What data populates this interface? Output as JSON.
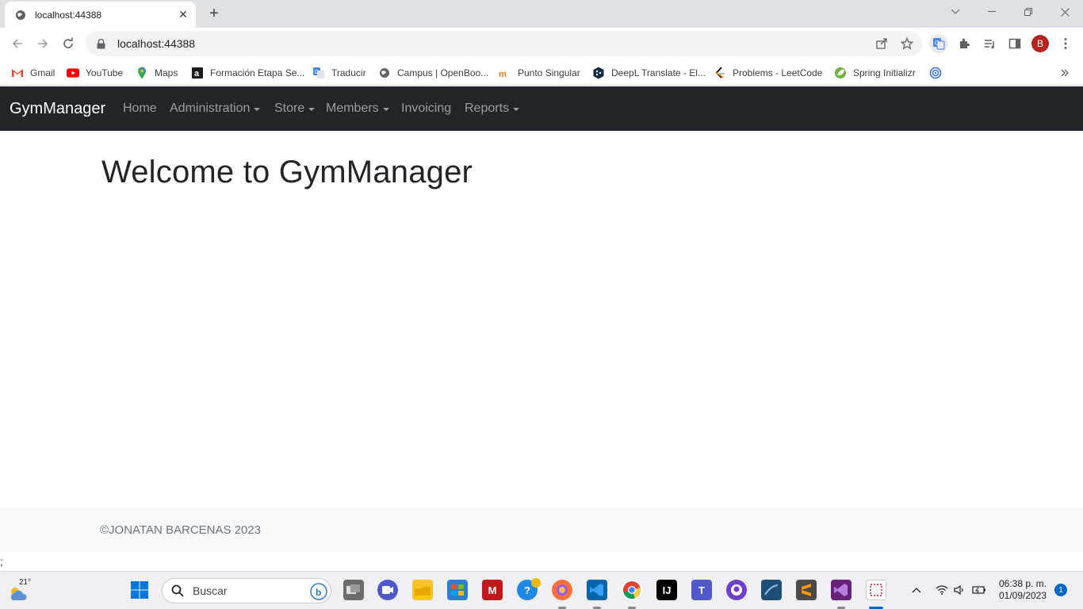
{
  "browser": {
    "tab_title": "localhost:44388",
    "url": "localhost:44388",
    "new_tab_label": "+",
    "profile_initial": "B"
  },
  "bookmarks": [
    {
      "label": "Gmail",
      "icon": "gmail-icon"
    },
    {
      "label": "YouTube",
      "icon": "youtube-icon"
    },
    {
      "label": "Maps",
      "icon": "maps-icon"
    },
    {
      "label": "Formación Etapa Se...",
      "icon": "academy-icon"
    },
    {
      "label": "Traducir",
      "icon": "translate-icon"
    },
    {
      "label": "Campus | OpenBoo...",
      "icon": "globe-icon"
    },
    {
      "label": "Punto Singular",
      "icon": "puntosingular-icon"
    },
    {
      "label": "DeepL Translate - El...",
      "icon": "deepl-icon"
    },
    {
      "label": "Problems - LeetCode",
      "icon": "leetcode-icon"
    },
    {
      "label": "Spring Initializr",
      "icon": "spring-icon"
    }
  ],
  "navbar": {
    "brand": "GymManager",
    "items": [
      {
        "label": "Home",
        "dropdown": false
      },
      {
        "label": "Administration",
        "dropdown": true
      },
      {
        "label": "Store",
        "dropdown": true
      },
      {
        "label": "Members",
        "dropdown": true
      },
      {
        "label": "Invoicing",
        "dropdown": false
      },
      {
        "label": "Reports",
        "dropdown": true
      }
    ]
  },
  "main": {
    "heading": "Welcome to GymManager"
  },
  "footer": {
    "text": "©JONATAN BARCENAS 2023"
  },
  "stray_text": ";",
  "taskbar": {
    "weather_temp": "21°",
    "search_placeholder": "Buscar",
    "time": "06:38 p. m.",
    "date": "01/09/2023",
    "notification_count": "1"
  },
  "colors": {
    "navbar_bg": "#212529",
    "footer_bg": "#f8f9fa",
    "heading": "#212529"
  }
}
